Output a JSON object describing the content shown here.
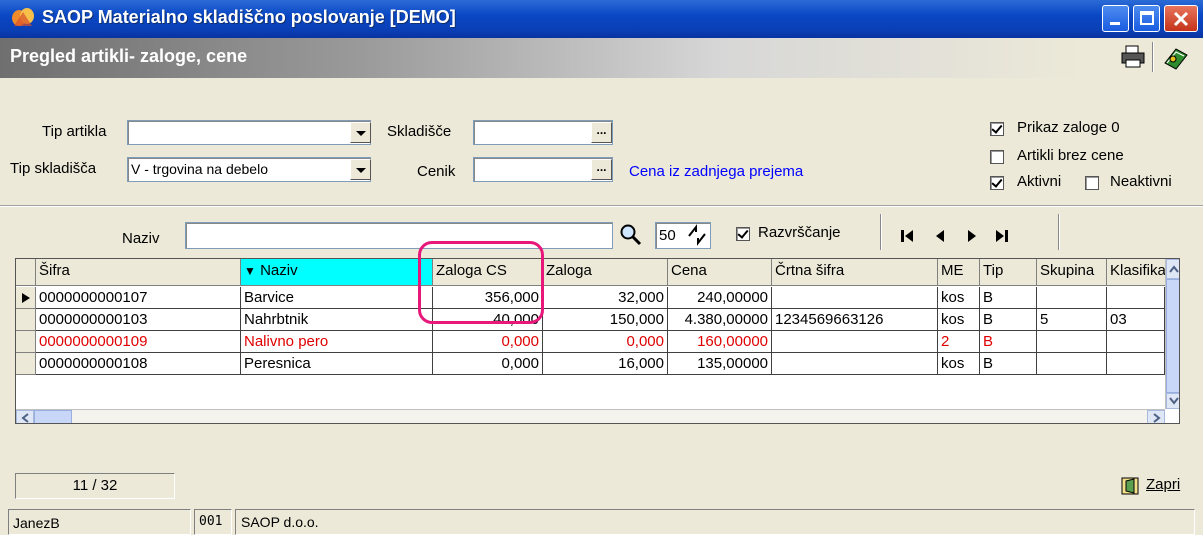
{
  "window": {
    "title": "SAOP Materialno skladiščno poslovanje [DEMO]"
  },
  "form": {
    "title": "Pregled artikli- zaloge, cene"
  },
  "filters": {
    "tip_artikla_label": "Tip artikla",
    "tip_artikla_value": "",
    "skladisce_label": "Skladišče",
    "skladisce_value": "",
    "tip_skladisca_label": "Tip skladišča",
    "tip_skladisca_value": "V - trgovina na debelo",
    "cenik_label": "Cenik",
    "cenik_value": "",
    "cena_link": "Cena iz zadnjega prejema",
    "ellipsis": "..."
  },
  "options": {
    "prikaz_zaloge_label": "Prikaz zaloge 0",
    "prikaz_zaloge_checked": true,
    "artikli_brez_cene_label": "Artikli brez cene",
    "artikli_brez_cene_checked": false,
    "aktivni_label": "Aktivni",
    "aktivni_checked": true,
    "neaktivni_label": "Neaktivni",
    "neaktivni_checked": false
  },
  "search": {
    "naziv_label": "Naziv",
    "naziv_value": "",
    "count_value": "50",
    "razvrscanje_label": "Razvrščanje",
    "razvrscanje_checked": true
  },
  "table": {
    "columns": [
      "Šifra",
      "Naziv",
      "Zaloga CS",
      "Zaloga",
      "Cena",
      "Črtna šifra",
      "ME",
      "Tip",
      "Skupina",
      "Klasifikac"
    ],
    "sorted_column_marker": "▼",
    "rows": [
      {
        "sifra": "0000000000107",
        "naziv": "Barvice",
        "zaloga_cs": "356,000",
        "zaloga": "32,000",
        "cena": "240,00000",
        "crtna": "",
        "me": "kos",
        "tip": "B",
        "skupina": "",
        "klasif": "",
        "red": false
      },
      {
        "sifra": "0000000000103",
        "naziv": "Nahrbtnik",
        "zaloga_cs": "40,000",
        "zaloga": "150,000",
        "cena": "4.380,00000",
        "crtna": "1234569663126",
        "me": "kos",
        "tip": "B",
        "skupina": "5",
        "klasif": "03",
        "red": false
      },
      {
        "sifra": "0000000000109",
        "naziv": "Nalivno pero",
        "zaloga_cs": "0,000",
        "zaloga": "0,000",
        "cena": "160,00000",
        "crtna": "",
        "me": "2",
        "tip": "B",
        "skupina": "",
        "klasif": "",
        "red": true
      },
      {
        "sifra": "0000000000108",
        "naziv": "Peresnica",
        "zaloga_cs": "0,000",
        "zaloga": "16,000",
        "cena": "135,00000",
        "crtna": "",
        "me": "kos",
        "tip": "B",
        "skupina": "",
        "klasif": "",
        "red": false
      }
    ]
  },
  "status": {
    "record_counter": "11 / 32",
    "close_label": "Zapri",
    "user": "JanezB",
    "company_code": "001",
    "company_name": "SAOP d.o.o."
  },
  "colors": {
    "highlight": "#e8187a",
    "selected_header": "#00ffff",
    "link": "#0000ff",
    "red_row": "#e00000"
  }
}
